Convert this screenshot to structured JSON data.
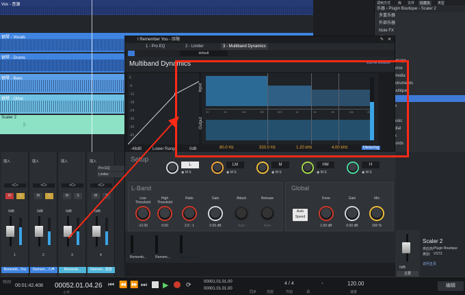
{
  "colors": {
    "accent": "#3f7ad6",
    "annotation": "#ff2a16",
    "track_blue": "#2f6fd0",
    "track_cyan": "#4fb6d9",
    "scaler_green": "#79e0b8",
    "knob_red": "#d03a2a"
  },
  "arrange": {
    "tracks": [
      {
        "label": "Vox - 音源",
        "color": "#3a63c8"
      },
      {
        "label": "钢琴 - Vocals",
        "color": "#3f84e0"
      },
      {
        "label": "钢琴 - Drums",
        "color": "#3f84e0"
      },
      {
        "label": "钢琴 - Bass",
        "color": "#5a9ee6"
      },
      {
        "label": "钢琴 - Other",
        "color": "#6fc1e4"
      },
      {
        "label": "Scaler 2",
        "color": "#8de2c5"
      }
    ]
  },
  "browser": {
    "topbar": [
      "乐器",
      "Plugin Boutique",
      "Scaler 2"
    ],
    "tabs": [
      "调用方式",
      "库",
      "文件",
      "收藏夹",
      "类型"
    ],
    "items": [
      "多重乐器",
      "外部乐器",
      "Note FX",
      "乐器",
      "效果器",
      "最近的",
      "Audio Damage",
      "Clairvoyance",
      "EK Multimedia",
      "Native Instruments",
      "Plugin Boutique",
      "Scaler 2",
      "PreSonus",
      "u-he",
      "Scaler Music",
      "State Digital",
      "Toontrack",
      "Sple Records"
    ],
    "selected_index": 11
  },
  "plugin": {
    "window_title": "I Remember You - 压限",
    "tabs": [
      "1 - Pro EQ",
      "2 - Limiter",
      "3 - Multiband Dynamics"
    ],
    "preset": "default",
    "name": "Multiband Dynamics",
    "edit_all": "Edit All Relative",
    "input_label": "Input",
    "output_label": "Output",
    "curve_ticks": [
      "0",
      "-6",
      "-12",
      "-18",
      "-24",
      "-30",
      "-36",
      "-42"
    ],
    "db_readout": "-48dB",
    "range_label": "Lower Range",
    "range_value": "0dB",
    "freq_ticks": [
      "20",
      "50",
      "100",
      "200",
      "500",
      "1k",
      "2k",
      "5k",
      "10k",
      "20k"
    ],
    "crossovers": [
      "80.0 Hz",
      "320.0 Hz",
      "1.20 kHz",
      "4.00 kHz"
    ],
    "metering": "Metering",
    "setup_label": "Setup",
    "bands": [
      {
        "name": "L"
      },
      {
        "name": "LM"
      },
      {
        "name": "M"
      },
      {
        "name": "HM"
      },
      {
        "name": "H"
      }
    ],
    "lband": {
      "title": "L-Band",
      "low_threshold_label": "Low\nThreshold",
      "low_threshold": "-12.00",
      "high_threshold_label": "High\nThreshold",
      "high_threshold": "0.00",
      "ratio_label": "Ratio",
      "ratio": "2.0 : 1",
      "gain_label": "Gain",
      "gain": "0.00 dB",
      "attack_label": "Attack",
      "attack": "Auto",
      "release_label": "Release",
      "release": "Auto"
    },
    "global": {
      "title": "Global",
      "auto_speed": "Auto\nSpeed",
      "knee_label": "Knee",
      "knee": "1.50 dB",
      "gain_label": "Gain",
      "gain": "0.00 dB",
      "mix_label": "Mix",
      "mix": "100 %"
    }
  },
  "mixer": {
    "insert_label": "插入",
    "sends_label": "发送",
    "strips": [
      {
        "num": "1",
        "pan": "<C>",
        "volume": "0dB",
        "name": "Rememb...You",
        "color": "#3f84e0"
      },
      {
        "num": "2",
        "pan": "<C>",
        "volume": "0dB",
        "name": "Remem...人声",
        "color": "#3f84e0"
      },
      {
        "num": "3",
        "pan": "<C>",
        "volume": "0dB",
        "name": "Rememb...",
        "color": "#4fb6d9"
      },
      {
        "num": "4",
        "pan": "<C>",
        "volume": "0dB",
        "name": "Remem...混音",
        "color": "#4fb6d9"
      }
    ],
    "extra_channels": [
      {
        "name": "Pro EQ"
      },
      {
        "name": "Limiter"
      }
    ],
    "lower_strips": [
      {
        "name": "Rememb...",
        "color": "#4fb6d9"
      },
      {
        "name": "Remem...",
        "color": "#4fb6d9"
      },
      {
        "name": "Scaler 2",
        "color": "#8de2c5"
      }
    ],
    "main_label": "主要",
    "main_volume": "0dB"
  },
  "instrument_info": {
    "name": "Scaler 2",
    "vendor_label": "供应商:",
    "vendor": "Plugin Boutique",
    "type_label": "类别:",
    "type": "VST3",
    "link": "访问主页"
  },
  "transport": {
    "time_label": "时间",
    "time": "00:01:42.408",
    "position": "00052.01.04.26",
    "bars_label": "小节",
    "loop_start": "00001.01.01.00",
    "loop_end": "00001.01.01.00",
    "sync_label": "同步",
    "perf_label": "性能",
    "time_sig": "4 / 4",
    "time_sig_label": "节拍",
    "key_label": "调",
    "tempo": "120.00",
    "tempo_label": "速度",
    "edit_tab": "编辑"
  }
}
